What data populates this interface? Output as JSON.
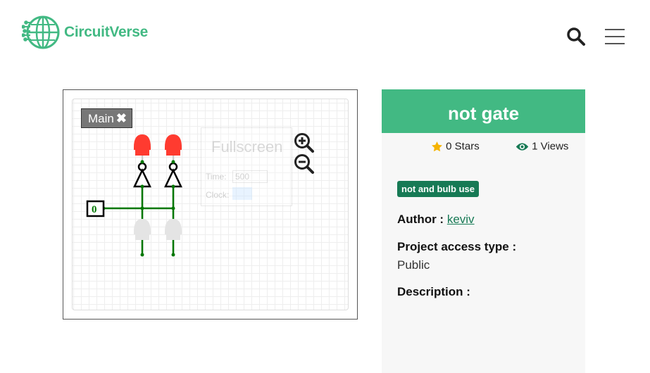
{
  "brand": {
    "name": "CircuitVerse",
    "color": "#42b983"
  },
  "header": {
    "icons": [
      "search-icon",
      "hamburger-menu-icon"
    ]
  },
  "preview": {
    "tab_label": "Main",
    "tab_close": "✖",
    "fullscreen_label": "Fullscreen",
    "timer_label": "Time:",
    "timer_value": "500",
    "clock_label": "Clock:",
    "input_value": "0"
  },
  "project": {
    "title": "not gate",
    "stars_count": "0 Stars",
    "views_count": "1 Views",
    "tag": "not and bulb use",
    "author_label": "Author :",
    "author_name": "keviv",
    "access_label": "Project access type :",
    "access_value": "Public",
    "description_label": "Description :"
  },
  "colors": {
    "accent": "#42b983",
    "tag": "#177a55",
    "star": "#f5b301",
    "wire": "#007700",
    "led_on": "#ff3b30"
  }
}
